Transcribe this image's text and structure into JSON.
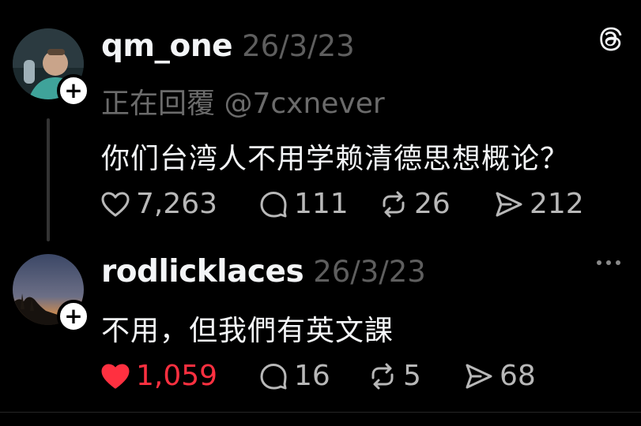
{
  "posts": [
    {
      "username": "qm_one",
      "date": "26/3/23",
      "reply_label": "正在回覆 @7cxnever",
      "text": "你们台湾人不用学赖清德思想概论？",
      "likes": "7,263",
      "liked": false,
      "comments": "111",
      "reposts": "26",
      "shares": "212"
    },
    {
      "username": "rodlicklaces",
      "date": "26/3/23",
      "text": "不用，但我們有英文課",
      "likes": "1,059",
      "liked": true,
      "comments": "16",
      "reposts": "5",
      "shares": "68"
    }
  ],
  "icons": {
    "app_logo": "threads-logo-icon",
    "like": "heart-icon",
    "comment": "comment-icon",
    "repost": "repost-icon",
    "share": "share-icon",
    "follow": "plus-icon",
    "more": "more-icon"
  },
  "colors": {
    "background": "#000000",
    "text": "#f3f5f7",
    "muted": "#5e5e5e",
    "liked": "#ff3040"
  }
}
